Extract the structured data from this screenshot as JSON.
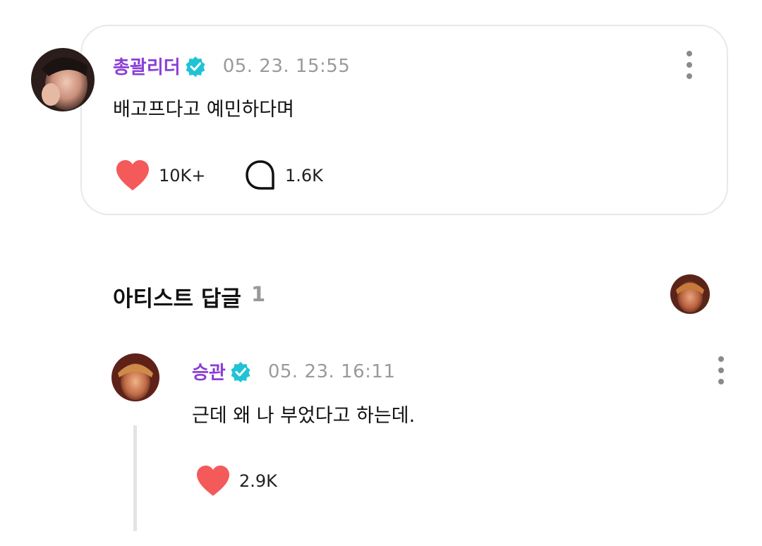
{
  "post": {
    "username": "총괄리더",
    "timestamp": "05. 23. 15:55",
    "message": "배고프다고 예민하다며",
    "likes": "10K+",
    "comments": "1.6K"
  },
  "artist_replies": {
    "title": "아티스트 답글",
    "count": "1"
  },
  "reply": {
    "username": "승관",
    "timestamp": "05. 23. 16:11",
    "message": "근데 왜 나 부었다고 하는데.",
    "likes": "2.9K"
  },
  "icons": {
    "verified": "verified-badge-icon",
    "like": "heart-icon",
    "comment": "speech-bubble-icon",
    "more": "more-vertical-icon"
  },
  "colors": {
    "username": "#8a3fd6",
    "verified": "#1fc3d6",
    "heart": "#f45a5a",
    "timestamp": "#9a9a9a",
    "card_border": "#e8e8e8"
  }
}
